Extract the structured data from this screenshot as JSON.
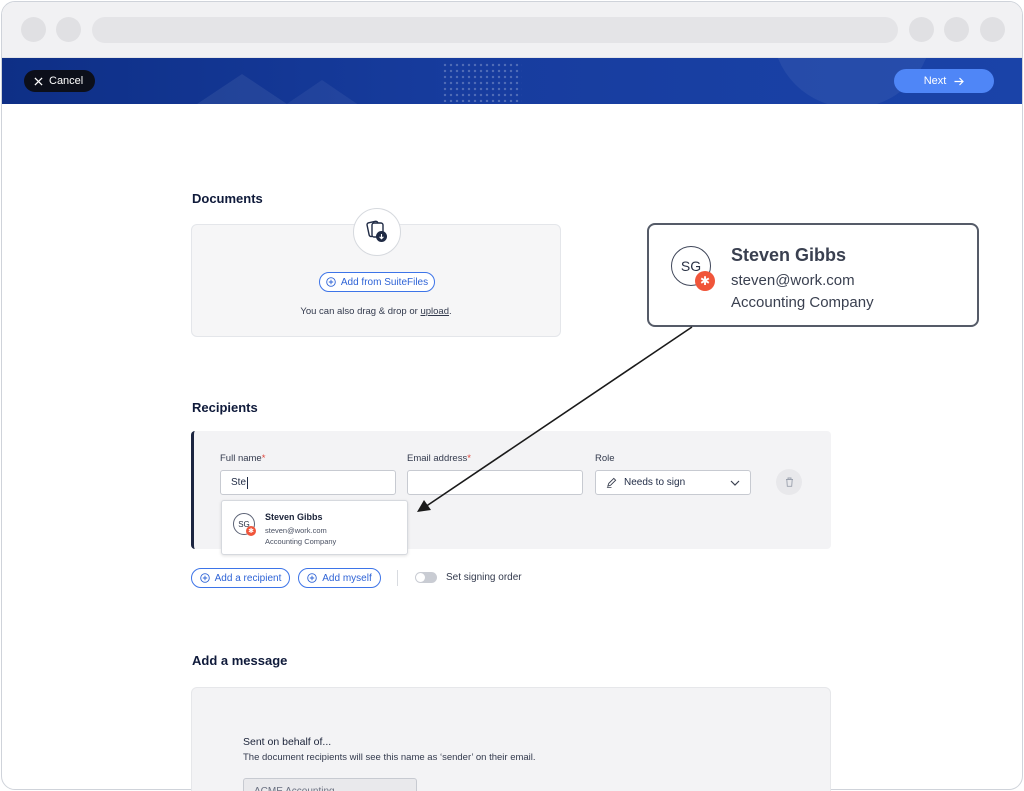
{
  "header": {
    "cancel_label": "Cancel",
    "next_label": "Next"
  },
  "documents": {
    "title": "Documents",
    "add_button_label": "Add from SuiteFiles",
    "hint_prefix": "You can also drag & drop or ",
    "hint_link": "upload",
    "hint_suffix": "."
  },
  "recipients": {
    "title": "Recipients",
    "full_name_label": "Full name",
    "email_label": "Email address",
    "role_label": "Role",
    "required_mark": "*",
    "full_name_value": "Ste",
    "email_value": "",
    "role_value": "Needs to sign",
    "suggestion": {
      "initials": "SG",
      "name": "Steven Gibbs",
      "email": "steven@work.com",
      "company": "Accounting Company"
    },
    "add_recipient_label": "Add a recipient",
    "add_myself_label": "Add myself",
    "signing_order_label": "Set signing order",
    "signing_order_enabled": false
  },
  "message": {
    "title": "Add a message",
    "behalf_title": "Sent on behalf of...",
    "behalf_desc": "The document recipients will see this name as ‘sender’ on their email.",
    "sender_value": "ACME Accounting"
  },
  "callout": {
    "initials": "SG",
    "name": "Steven Gibbs",
    "email": "steven@work.com",
    "company": "Accounting Company"
  },
  "colors": {
    "brand_blue": "#1a43a8",
    "accent": "#4f86f7",
    "hubspot": "#f0553a"
  }
}
